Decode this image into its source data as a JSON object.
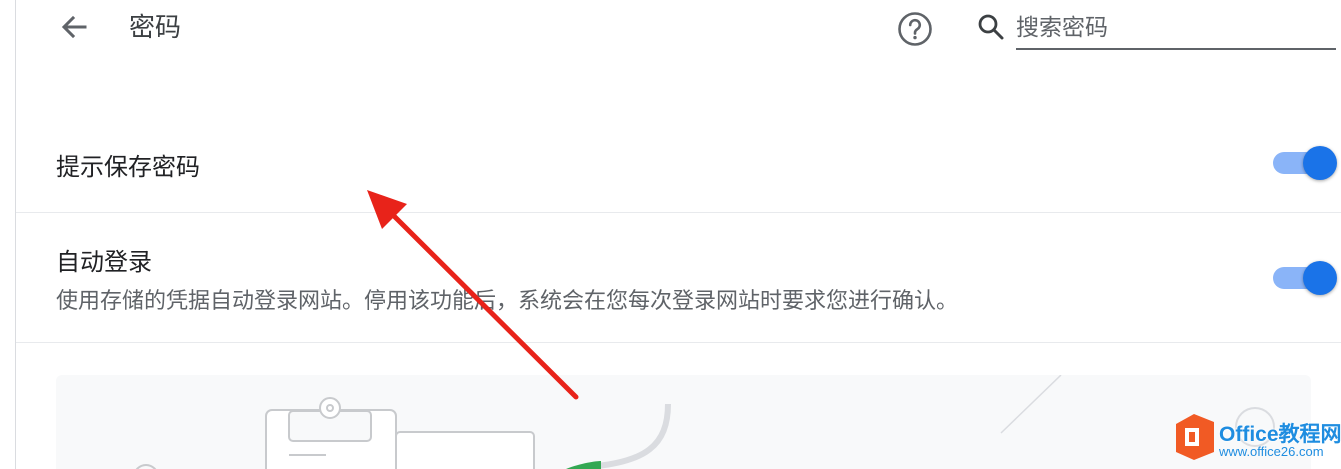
{
  "header": {
    "title": "密码",
    "back_icon": "arrow-back-icon",
    "help_icon": "help-circle-icon",
    "search_icon": "search-icon",
    "search_placeholder": "搜索密码"
  },
  "settings": [
    {
      "title": "提示保存密码",
      "description": "",
      "enabled": true
    },
    {
      "title": "自动登录",
      "description": "使用存储的凭据自动登录网站。停用该功能后，系统会在您每次登录网站时要求您进行确认。",
      "enabled": true
    }
  ],
  "watermark": {
    "brand": "Office教程网",
    "url": "www.office26.com"
  },
  "colors": {
    "accent": "#1a73e8",
    "toggle_track": "#8ab4f8",
    "annotation_arrow": "#e8231a",
    "watermark": "#1f8de0"
  }
}
